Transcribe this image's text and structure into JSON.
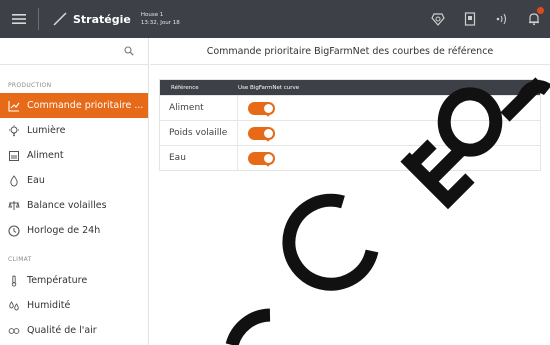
{
  "header": {
    "title": "Stratégie",
    "house": "House 1",
    "datetime": "13:32, Jour 18"
  },
  "sidebar": {
    "sections": [
      {
        "label": "PRODUCTION"
      },
      {
        "label": "CLIMAT"
      }
    ],
    "items": [
      {
        "label": "Commande prioritaire ...",
        "icon": "chart-icon",
        "active": true
      },
      {
        "label": "Lumière",
        "icon": "bulb-icon"
      },
      {
        "label": "Aliment",
        "icon": "feed-icon"
      },
      {
        "label": "Eau",
        "icon": "drop-icon"
      },
      {
        "label": "Balance volailles",
        "icon": "scale-icon"
      },
      {
        "label": "Horloge de 24h",
        "icon": "clock-icon"
      },
      {
        "label": "Température",
        "icon": "thermometer-icon"
      },
      {
        "label": "Humidité",
        "icon": "humidity-icon"
      },
      {
        "label": "Qualité de l'air",
        "icon": "co2-icon"
      }
    ]
  },
  "main": {
    "title": "Commande prioritaire BigFarmNet des courbes de référence",
    "table": {
      "headers": [
        "Référence",
        "Use BigFarmNet curve"
      ],
      "rows": [
        {
          "label": "Aliment",
          "enabled": true
        },
        {
          "label": "Poids volaille",
          "enabled": true
        },
        {
          "label": "Eau",
          "enabled": true
        }
      ]
    }
  },
  "watermark": {
    "text": "Production",
    "color": "#000000"
  },
  "colors": {
    "accent": "#e66a18",
    "topbar": "#3d4047",
    "badge": "#e04a1a"
  }
}
